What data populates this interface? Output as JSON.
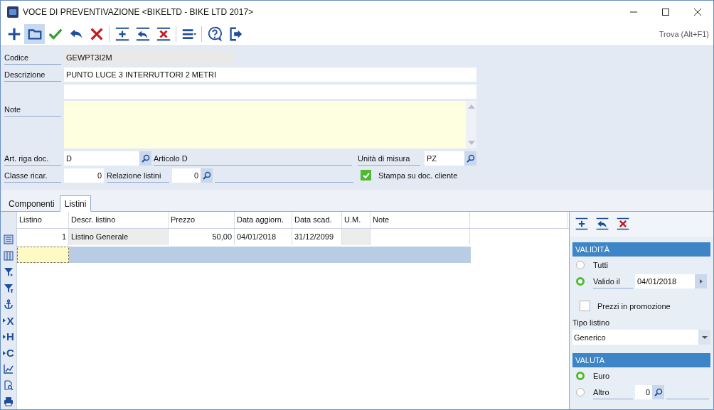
{
  "window": {
    "title": "VOCE DI PREVENTIVAZIONE <BIKELTD - BIKE LTD 2017>"
  },
  "toolbar": {
    "buttons": [
      {
        "kind": "plus",
        "selected": false
      },
      {
        "kind": "folder",
        "selected": true
      },
      {
        "kind": "check",
        "selected": false
      },
      {
        "kind": "undo",
        "selected": false
      },
      {
        "kind": "delete",
        "selected": false
      },
      {
        "kind": "sep"
      },
      {
        "kind": "row-plus",
        "selected": false
      },
      {
        "kind": "row-undo",
        "selected": false
      },
      {
        "kind": "row-delete",
        "selected": false
      },
      {
        "kind": "sep"
      },
      {
        "kind": "menu",
        "selected": false
      },
      {
        "kind": "sep"
      },
      {
        "kind": "help",
        "selected": false
      },
      {
        "kind": "exit",
        "selected": false
      }
    ],
    "search": {
      "placeholder": "Trova (Alt+F1)"
    }
  },
  "form": {
    "codice": {
      "label": "Codice",
      "value": "GEWPT3I2M"
    },
    "descrizione": {
      "label": "Descrizione",
      "value": "PUNTO LUCE 3 INTERRUTTORI 2 METRI"
    },
    "note": {
      "label": "Note"
    },
    "articolo": {
      "label": "Art. riga doc.",
      "value": "D",
      "description": "Articolo D"
    },
    "unita": {
      "label": "Unità di misura",
      "value": "PZ"
    },
    "classe": {
      "label": "Classe ricar.",
      "value": "0"
    },
    "relazione": {
      "label": "Relazione listini",
      "value": "0"
    },
    "stampa": {
      "label": "Stampa su doc. cliente",
      "checked": true
    }
  },
  "tabs": [
    {
      "label": "Componenti",
      "selected": false
    },
    {
      "label": "Listini",
      "selected": true
    }
  ],
  "side_tools": [
    {
      "kind": "list"
    },
    {
      "kind": "columns"
    },
    {
      "kind": "filter"
    },
    {
      "kind": "filter-sort"
    },
    {
      "kind": "anchor"
    },
    {
      "kind": "letter",
      "label": "X"
    },
    {
      "kind": "letter",
      "label": "H"
    },
    {
      "kind": "letter",
      "label": "C"
    },
    {
      "kind": "chart"
    },
    {
      "kind": "preview"
    },
    {
      "kind": "print"
    }
  ],
  "table": {
    "columns": [
      {
        "label": "Listino",
        "readonly": false
      },
      {
        "label": "Descr. listino",
        "readonly": true
      },
      {
        "label": "Prezzo",
        "readonly": false
      },
      {
        "label": "Data aggiorn.",
        "readonly": false
      },
      {
        "label": "Data scad.",
        "readonly": false
      },
      {
        "label": "U.M.",
        "readonly": true
      },
      {
        "label": "Note",
        "readonly": false
      }
    ],
    "rows": [
      {
        "cells": [
          "1",
          "Listino Generale",
          "50,00",
          "04/01/2018",
          "31/12/2099",
          "",
          ""
        ]
      }
    ]
  },
  "panel": {
    "tools": [
      {
        "kind": "row-plus"
      },
      {
        "kind": "row-undo"
      },
      {
        "kind": "row-delete"
      }
    ],
    "validita": {
      "title": "VALIDITÀ",
      "options": [
        {
          "label": "Tutti",
          "selected": false
        },
        {
          "label": "Valido il",
          "selected": true
        }
      ],
      "date": "04/01/2018"
    },
    "promozione": {
      "label": "Prezzi in promozione",
      "checked": false
    },
    "tipo": {
      "label": "Tipo listino",
      "value": "Generico"
    },
    "valuta": {
      "title": "VALUTA",
      "options": [
        {
          "label": "Euro",
          "selected": true
        },
        {
          "label": "Altro",
          "selected": false
        }
      ],
      "altro_value": "0"
    }
  }
}
